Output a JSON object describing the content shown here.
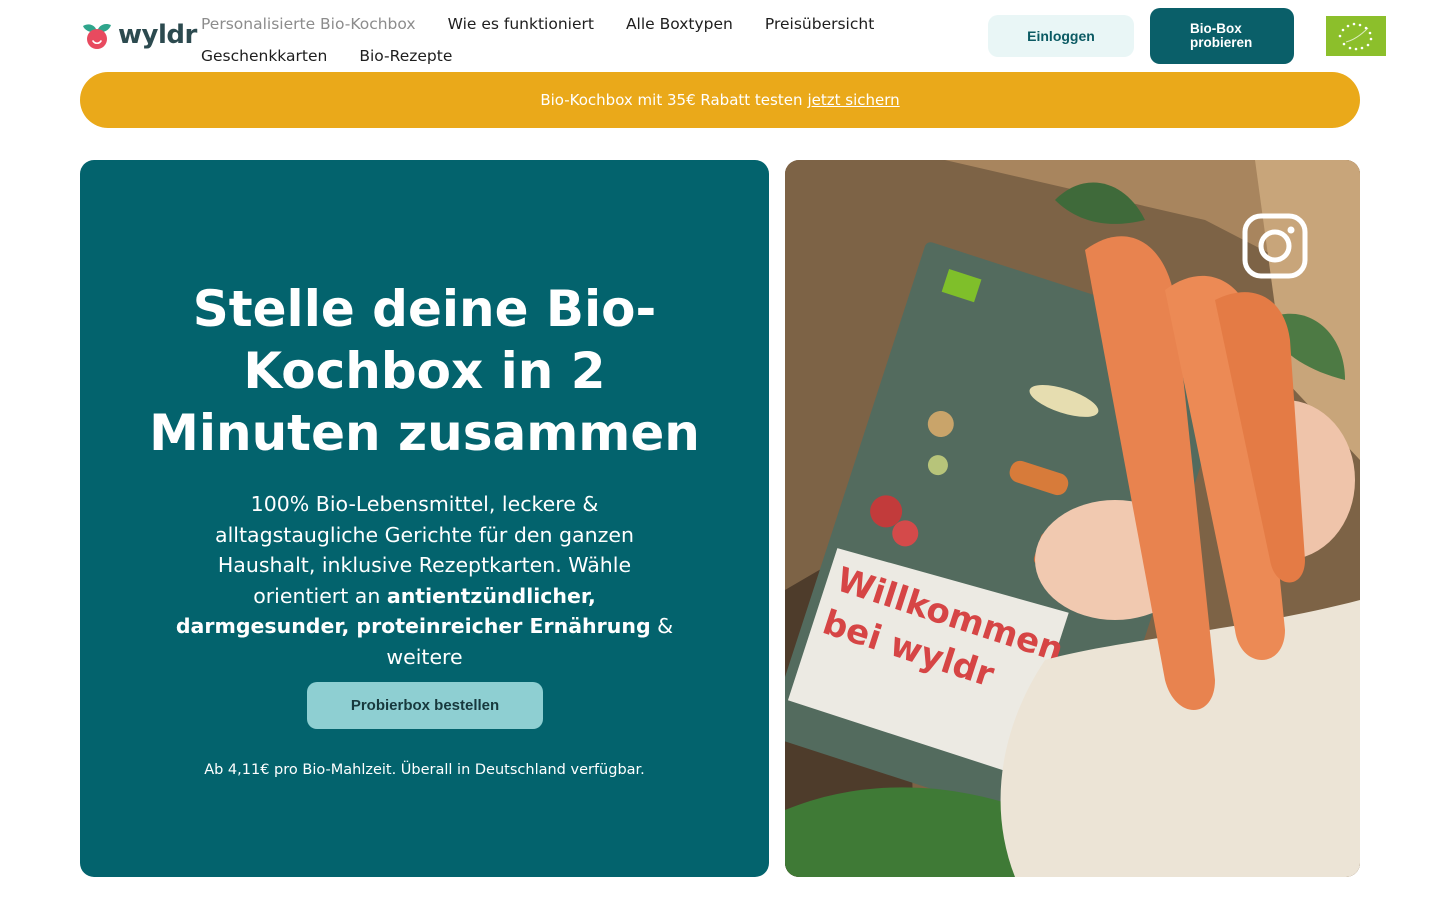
{
  "brand": {
    "name": "wyldr"
  },
  "nav": {
    "row1": [
      "Personalisierte Bio-Kochbox",
      "Wie es funktioniert",
      "Alle Boxtypen",
      "Preisübersicht"
    ],
    "row2": [
      "Geschenkkarten",
      "Bio-Rezepte"
    ]
  },
  "header": {
    "login_label": "Einloggen",
    "try_label_line1": "Bio-Box",
    "try_label_line2": "probieren"
  },
  "promo": {
    "text": "Bio-Kochbox mit 35€ Rabatt testen",
    "link_label": "jetzt sichern"
  },
  "hero": {
    "title": "Stelle deine Bio-Kochbox in 2 Minuten zusammen",
    "text_part1": "100% Bio-Lebensmittel, leckere & alltagstaugliche Gerichte für den ganzen Haushalt, inklusive Rezeptkarten. Wähle orientiert an ",
    "text_bold": "antientzündlicher, darmgesunder, proteinreicher Ernährung",
    "text_part2": " & weitere",
    "cta_label": "Probierbox bestellen",
    "note": "Ab 4,11€ pro Bio-Mahlzeit. Überall in Deutschland verfügbar."
  },
  "media": {
    "card_text_line1": "Willkommen",
    "card_text_line2": "bei wyldr"
  },
  "colors": {
    "primary": "#03636d",
    "promo": "#eaa91a",
    "cta": "#8ecfd2",
    "login_bg": "#e9f6f6",
    "eu_green": "#8cbf2b"
  },
  "icons": [
    "logo-leaf-icon",
    "eu-organic-logo-icon",
    "instagram-icon"
  ]
}
